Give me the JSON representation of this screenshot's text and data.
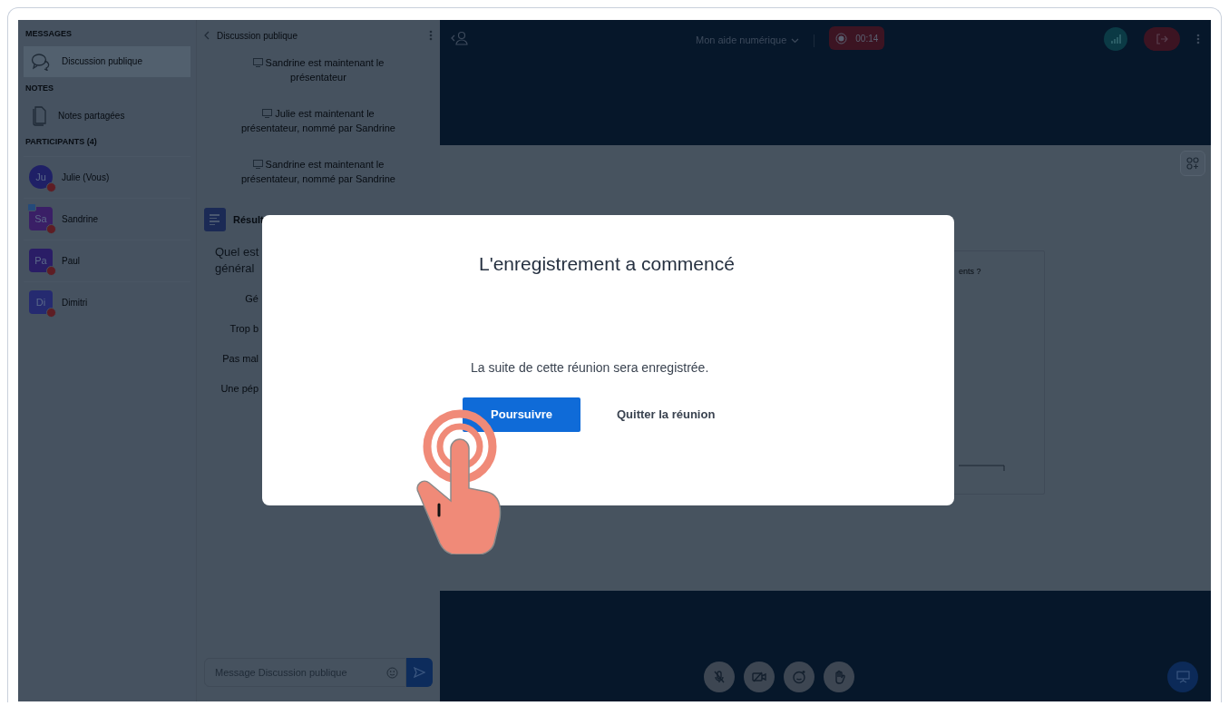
{
  "sidebar": {
    "sections": [
      {
        "title": "MESSAGES",
        "kind": "chat",
        "items": [
          {
            "label": "Discussion publique",
            "selected": true
          }
        ]
      },
      {
        "title": "NOTES",
        "kind": "notes",
        "items": [
          {
            "label": "Notes partagées",
            "selected": false
          }
        ]
      }
    ],
    "participants_title": "PARTICIPANTS (4)",
    "participants": [
      {
        "initials": "Ju",
        "name": "Julie (Vous)",
        "color": "#1f2066",
        "presenter": false
      },
      {
        "initials": "Sa",
        "name": "Sandrine",
        "color": "#3a1f66",
        "presenter": true
      },
      {
        "initials": "Pa",
        "name": "Paul",
        "color": "#2a1d66",
        "presenter": false
      },
      {
        "initials": "Di",
        "name": "Dimitri",
        "color": "#252a70",
        "presenter": false
      }
    ]
  },
  "chat": {
    "title": "Discussion publique",
    "messages": [
      {
        "lines": [
          "Sandrine est maintenant le",
          "présentateur"
        ]
      },
      {
        "lines": [
          "Julie est maintenant le",
          "présentateur, nommé par Sandrine"
        ]
      },
      {
        "lines": [
          "Sandrine est maintenant le",
          "présentateur, nommé par Sandrine"
        ]
      }
    ],
    "poll": {
      "title": "Résult",
      "question_lines": [
        "Quel est",
        "général"
      ],
      "options": [
        "Gé",
        "Trop b",
        "Pas mal",
        "Une pép"
      ]
    },
    "input": {
      "placeholder": "Message Discussion publique"
    }
  },
  "topbar": {
    "meeting": "Mon aide numérique",
    "recording": true,
    "timer": "00:14"
  },
  "whiteboard": {
    "text": "ents ?"
  },
  "controls": [
    {
      "kind": "mic"
    },
    {
      "kind": "camera"
    },
    {
      "kind": "emoji"
    },
    {
      "kind": "hand"
    }
  ],
  "modal": {
    "title": "L'enregistrement a commencé",
    "body": "La suite de cette réunion sera enregistrée.",
    "primary": "Poursuivre",
    "secondary": "Quitter la réunion"
  }
}
